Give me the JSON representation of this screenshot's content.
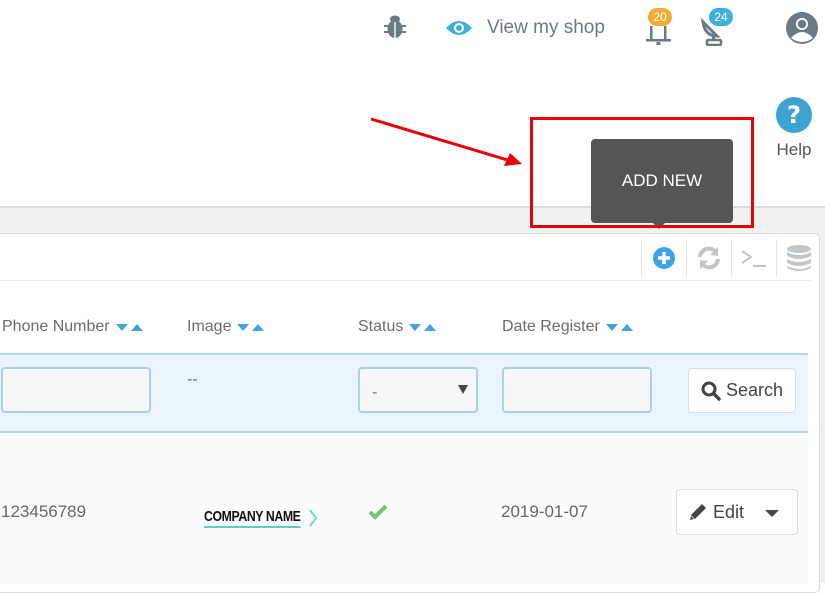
{
  "topbar": {
    "view_shop_label": "View my shop",
    "notifications_count": "20",
    "messages_count": "24",
    "icons": [
      "bug-icon",
      "eye-icon",
      "bell-icon",
      "satellite-dish-icon",
      "user-avatar-icon"
    ]
  },
  "header": {
    "help_label": "Help"
  },
  "tooltip": {
    "text": "ADD NEW"
  },
  "toolbar": {
    "icons": [
      "add-new-icon",
      "refresh-icon",
      "sql-query-icon",
      "database-export-icon"
    ]
  },
  "table": {
    "columns": [
      {
        "label": "Phone Number"
      },
      {
        "label": "Image"
      },
      {
        "label": "Status"
      },
      {
        "label": "Date Register"
      }
    ],
    "filters": {
      "phone_value": "",
      "image_placeholder": "--",
      "status_selected": "-",
      "date_value": "",
      "search_label": "Search"
    },
    "rows": [
      {
        "phone": "123456789",
        "image_logo_text": "COMPANY NAME",
        "status": "enabled",
        "date": "2019-01-07",
        "action_label": "Edit"
      }
    ]
  },
  "colors": {
    "accent_blue": "#3ea3e0",
    "badge_orange": "#f0ad32",
    "badge_blue": "#3eb1d9",
    "annotation_red": "#e8000b",
    "tooltip_bg": "#555555",
    "status_green": "#72c279"
  }
}
